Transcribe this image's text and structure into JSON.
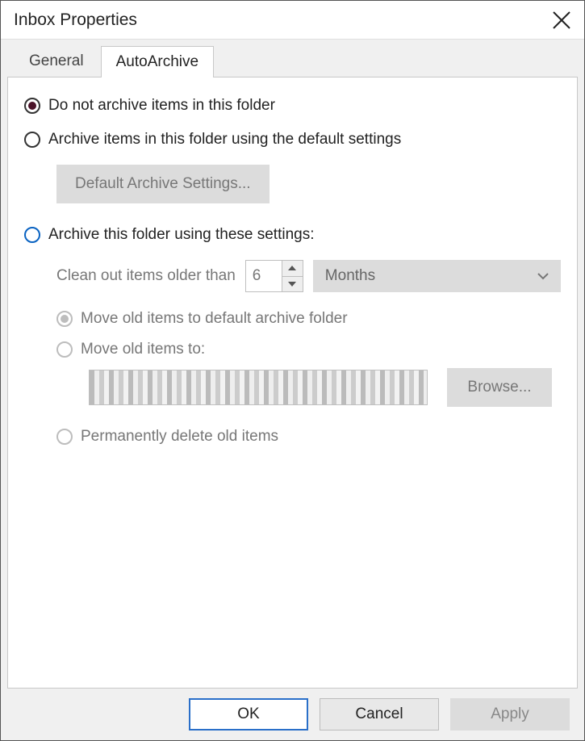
{
  "window": {
    "title": "Inbox Properties"
  },
  "tabs": {
    "general": "General",
    "autoarchive": "AutoArchive"
  },
  "options": {
    "do_not_archive": "Do not archive items in this folder",
    "default_archive": "Archive items in this folder using the default settings",
    "default_btn": "Default Archive Settings...",
    "custom_archive": "Archive this folder using these settings:",
    "clean_label": "Clean out items older than",
    "clean_value": "6",
    "clean_unit": "Months",
    "move_default": "Move old items to default archive folder",
    "move_to": "Move old items to:",
    "browse": "Browse...",
    "perm_delete": "Permanently delete old items"
  },
  "buttons": {
    "ok": "OK",
    "cancel": "Cancel",
    "apply": "Apply"
  }
}
